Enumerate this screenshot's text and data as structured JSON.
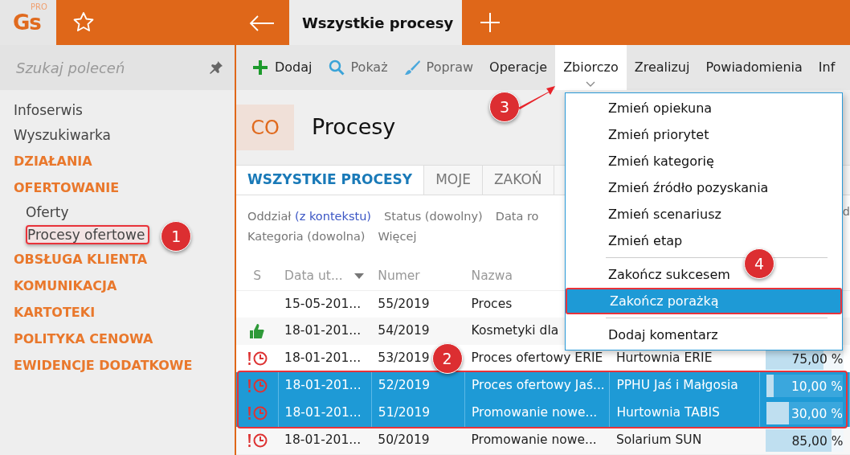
{
  "app": {
    "logo": "Gs",
    "logo_badge": "PRO"
  },
  "tabs": [
    {
      "label": "Wszystkie procesy",
      "selected": true
    }
  ],
  "sidebar": {
    "search": {
      "placeholder": "Szukaj poleceń"
    },
    "items": [
      {
        "label": "Infoserwis",
        "kind": "link"
      },
      {
        "label": "Wyszukiwarka",
        "kind": "link"
      },
      {
        "label": "DZIAŁANIA",
        "kind": "section"
      },
      {
        "label": "OFERTOWANIE",
        "kind": "section",
        "children": [
          {
            "label": "Oferty",
            "highlighted": false
          },
          {
            "label": "Procesy ofertowe",
            "highlighted": true
          }
        ]
      },
      {
        "label": "OBSŁUGA KLIENTA",
        "kind": "section"
      },
      {
        "label": "KOMUNIKACJA",
        "kind": "section"
      },
      {
        "label": "KARTOTEKI",
        "kind": "section"
      },
      {
        "label": "POLITYKA CENOWA",
        "kind": "section"
      },
      {
        "label": "EWIDENCJE DODATKOWE",
        "kind": "section"
      }
    ]
  },
  "toolbar": [
    {
      "label": "Dodaj",
      "kind": "add",
      "selected": false
    },
    {
      "label": "Pokaż",
      "kind": "show",
      "selected": false
    },
    {
      "label": "Popraw",
      "kind": "edit",
      "selected": false
    },
    {
      "label": "Operacje",
      "kind": "text",
      "selected": false
    },
    {
      "label": "Zbiorczo",
      "kind": "text",
      "selected": true
    },
    {
      "label": "Zrealizuj",
      "kind": "text",
      "selected": false
    },
    {
      "label": "Powiadomienia",
      "kind": "text",
      "selected": false
    },
    {
      "label": "Inf",
      "kind": "text",
      "selected": false
    }
  ],
  "header": {
    "badge": "CO",
    "title": "Procesy"
  },
  "view_tabs": [
    {
      "label": "WSZYSTKIE PROCESY",
      "selected": true
    },
    {
      "label": "MOJE",
      "selected": false
    },
    {
      "label": "ZAKOŃ",
      "selected": false
    }
  ],
  "filters": [
    [
      {
        "label": "Oddział",
        "value": "(z kontekstu)"
      },
      {
        "label": "Status (dowolny)"
      },
      {
        "label": "Data ro"
      }
    ],
    [
      {
        "label": "Kategoria (dowolna)"
      },
      {
        "label": "Więcej"
      }
    ]
  ],
  "filters_edge": "d",
  "table": {
    "columns": [
      "S",
      "Data ut...",
      "Numer",
      "Nazwa"
    ],
    "rows": [
      {
        "kind": "plain",
        "date": "15-05-201...",
        "number": "55/2019",
        "name": "Proces",
        "selected": false
      },
      {
        "kind": "success",
        "date": "18-01-201...",
        "number": "54/2019",
        "name": "Kosmetyki dla",
        "selected": false
      },
      {
        "kind": "overdue",
        "date": "18-01-201...",
        "number": "53/2019",
        "name": "Proces ofertowy ERIE",
        "column_5": "Hurtownia ERIE",
        "level": 0.75,
        "reading": "75,00 %",
        "selected": false
      },
      {
        "kind": "overdue",
        "date": "18-01-201...",
        "number": "52/2019",
        "name": "Proces ofertowy Jaś...",
        "column_5": "PPHU Jaś i Małgosia",
        "level": 0.1,
        "reading": "10,00 %",
        "selected": true
      },
      {
        "kind": "overdue",
        "date": "18-01-201...",
        "number": "51/2019",
        "name": "Promowanie nowe...",
        "column_5": "Hurtownia TABIS",
        "level": 0.3,
        "reading": "30,00 %",
        "selected": true
      },
      {
        "kind": "overdue",
        "date": "18-01-201...",
        "number": "50/2019",
        "name": "Promowanie nowe...",
        "column_5": "Solarium SUN",
        "level": 0.85,
        "reading": "85,00 %",
        "selected": false
      }
    ]
  },
  "dropdown": {
    "items": [
      {
        "kind": "item",
        "label": "Zmień opiekuna",
        "highlighted": false
      },
      {
        "kind": "item",
        "label": "Zmień priorytet",
        "highlighted": false
      },
      {
        "kind": "item",
        "label": "Zmień kategorię",
        "highlighted": false
      },
      {
        "kind": "item",
        "label": "Zmień źródło pozyskania",
        "highlighted": false
      },
      {
        "kind": "item",
        "label": "Zmień scenariusz",
        "highlighted": false
      },
      {
        "kind": "item",
        "label": "Zmień etap",
        "highlighted": false
      },
      {
        "kind": "separator"
      },
      {
        "kind": "item",
        "label": "Zakończ sukcesem",
        "highlighted": false
      },
      {
        "kind": "item",
        "label": "Zakończ porażką",
        "highlighted": true
      },
      {
        "kind": "separator"
      },
      {
        "kind": "item",
        "label": "Dodaj komentarz",
        "highlighted": false
      }
    ]
  },
  "annotations": [
    "1",
    "2",
    "3",
    "4"
  ]
}
